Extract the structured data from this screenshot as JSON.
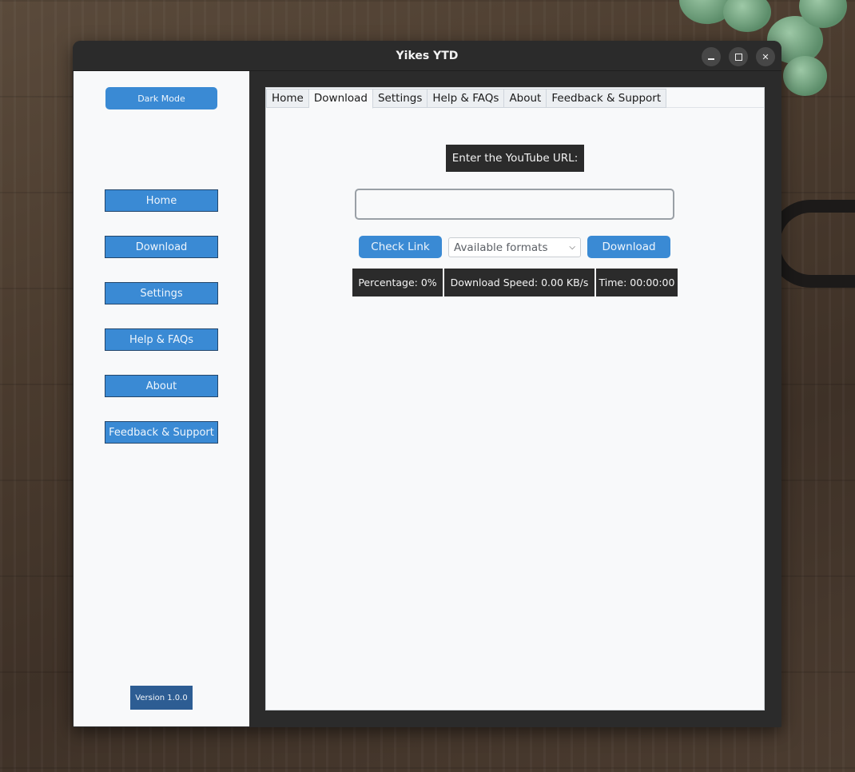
{
  "window": {
    "title": "Yikes YTD"
  },
  "window_controls": {
    "minimize_icon": "minimize-icon",
    "maximize_icon": "maximize-icon",
    "close_icon": "close-icon",
    "close_glyph": "✕"
  },
  "sidebar": {
    "dark_mode_label": "Dark Mode",
    "items": [
      {
        "label": "Home"
      },
      {
        "label": "Download"
      },
      {
        "label": "Settings"
      },
      {
        "label": "Help & FAQs"
      },
      {
        "label": "About"
      },
      {
        "label": "Feedback & Support"
      }
    ],
    "version": "Version 1.0.0"
  },
  "tabs": [
    {
      "label": "Home",
      "active": false
    },
    {
      "label": "Download",
      "active": true
    },
    {
      "label": "Settings",
      "active": false
    },
    {
      "label": "Help & FAQs",
      "active": false
    },
    {
      "label": "About",
      "active": false
    },
    {
      "label": "Feedback & Support",
      "active": false
    }
  ],
  "download": {
    "url_label": "Enter the YouTube URL:",
    "url_value": "",
    "check_link_label": "Check Link",
    "formats_selected": "Available formats",
    "download_label": "Download",
    "percentage": "Percentage: 0%",
    "speed": "Download Speed: 0.00 KB/s",
    "time": "Time: 00:00:00"
  },
  "colors": {
    "accent_blue": "#3a8ad4",
    "dark_label": "#2b2b2b",
    "version_bg": "#2d5d93",
    "panel_bg": "#f8f9fa"
  }
}
